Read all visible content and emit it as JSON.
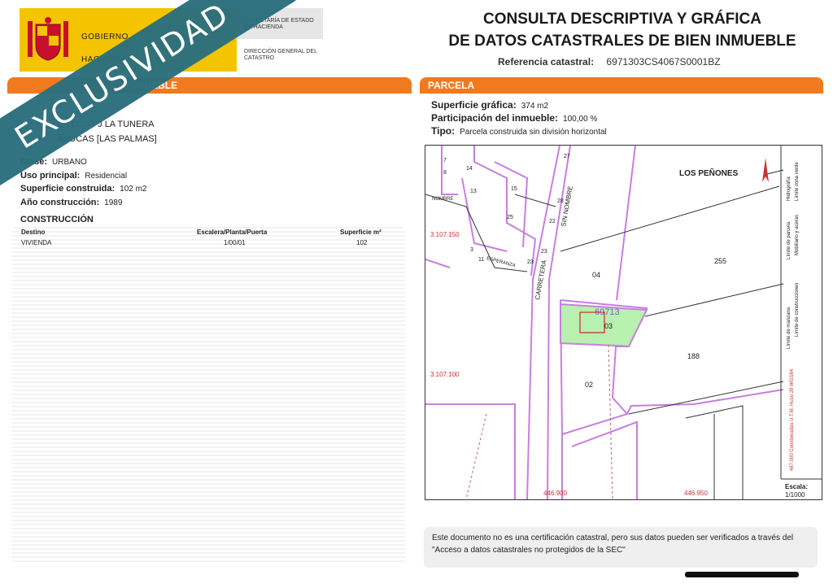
{
  "header": {
    "logo_text_1": "GOBIERNO",
    "logo_text_2": "HACIENDA",
    "agency_1": "SECRETARÍA DE ESTADO DE HACIENDA",
    "agency_2": "DIRECCIÓN GENERAL DEL CATASTRO",
    "title_line_1": "CONSULTA DESCRIPTIVA Y GRÁFICA",
    "title_line_2": "DE DATOS CATASTRALES DE BIEN INMUEBLE",
    "ref_label": "Referencia catastral:",
    "ref_value": "6971303CS4067S0001BZ"
  },
  "left": {
    "section_title": "DATOS DESCRIPTIVOS DEL INMUEBLE",
    "section_title_visible": "EL INMUEBLE",
    "address_line_1": "ES LOS  PJ LA TUNERA",
    "address_line_2": "ARUCAS [LAS PALMAS]",
    "clase_label": "Clase:",
    "clase_value": "URBANO",
    "uso_label": "Uso principal:",
    "uso_value": "Residencial",
    "superficie_label": "Superficie construida:",
    "superficie_value": "102 m2",
    "anio_label": "Año construcción:",
    "anio_value": "1989",
    "construccion_title": "CONSTRUCCIÓN",
    "table": {
      "headers": [
        "Destino",
        "Escalera/Planta/Puerta",
        "Superficie m²"
      ],
      "rows": [
        [
          "VIVIENDA",
          "1/00/01",
          "102"
        ]
      ]
    }
  },
  "right": {
    "section_title": "PARCELA",
    "sup_label": "Superficie gráfica:",
    "sup_value": "374 m2",
    "part_label": "Participación del inmueble:",
    "part_value": "100,00 %",
    "tipo_label": "Tipo:",
    "tipo_value": "Parcela construida sin división horizontal"
  },
  "map": {
    "place_label": "LOS PEÑONES",
    "parcel_label": "69713",
    "parcel_numbers": [
      "04",
      "03",
      "02",
      "255",
      "188"
    ],
    "street_1": "CARRETERA",
    "street_2": "SIN NOMBRE",
    "street_3": "NOMBRE",
    "street_4": "ESPERANZA",
    "coord_y_1": "3.107.150",
    "coord_y_2": "3.107.100",
    "coord_x_1": "446.900",
    "coord_x_2": "446.950",
    "house_numbers": [
      "27",
      "28",
      "22",
      "23",
      "25",
      "23",
      "11",
      "3",
      "13",
      "14",
      "15",
      "7",
      "8"
    ],
    "scale_label": "Escala:",
    "scale_value": "1/1000",
    "legend": [
      "Límite de manzana",
      "Límite de parcela",
      "Límite de construcciones",
      "Mobiliario y aceras",
      "Límite zona verde",
      "Hidrografía"
    ],
    "legend_coord": "447.000 Coordenadas U.T.M. Huso 28 WGS84"
  },
  "footer": {
    "note": "Este documento no es una certificación catastral, pero sus datos pueden ser verificados a través del \"Acceso a datos catastrales no protegidos de la SEC\""
  },
  "watermark": "EXCLUSIVIDAD",
  "colors": {
    "accent_orange": "#f07a1d",
    "logo_yellow": "#f4c400",
    "banner_teal": "#2b6f7d",
    "parcel_green": "#b8f0b0",
    "boundary_purple": "#c77fe0"
  }
}
